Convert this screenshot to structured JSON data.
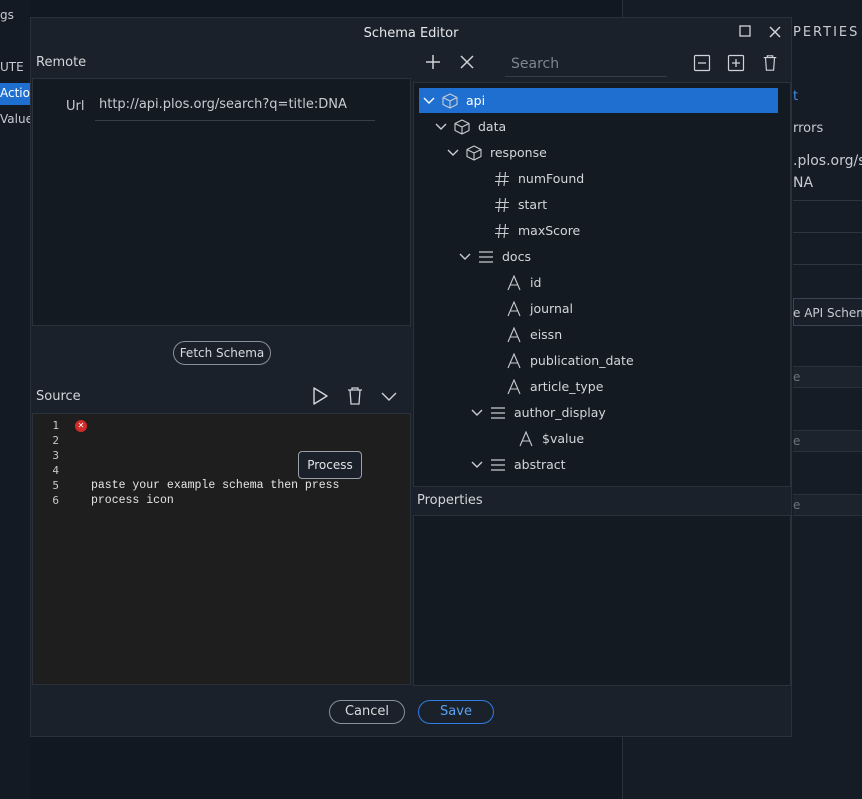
{
  "background_left": {
    "items": [
      "gs",
      "UTE",
      "Actio",
      "Value"
    ]
  },
  "background_right": {
    "header": "PERTIES",
    "items": [
      "t",
      "rrors",
      ".plos.org/s",
      "NA",
      "e API Schema",
      "e",
      "e",
      "e"
    ]
  },
  "dialog": {
    "title": "Schema Editor",
    "remote": {
      "section_label": "Remote",
      "url_label": "Url",
      "url_value": "http://api.plos.org/search?q=title:DNA",
      "fetch_button": "Fetch Schema"
    },
    "source": {
      "section_label": "Source",
      "line_numbers": [
        "1",
        "2",
        "3",
        "4",
        "5",
        "6"
      ],
      "lines": [
        "",
        "",
        "",
        "",
        "paste your example schema then press",
        "process icon"
      ],
      "tooltip": "Process"
    },
    "tree": {
      "search_placeholder": "Search",
      "nodes": [
        {
          "label": "api",
          "icon": "cube-icon",
          "expanded": true,
          "selected": true
        },
        {
          "label": "data",
          "icon": "cube-icon",
          "expanded": true
        },
        {
          "label": "response",
          "icon": "cube-icon",
          "expanded": true
        },
        {
          "label": "numFound",
          "icon": "hash-icon"
        },
        {
          "label": "start",
          "icon": "hash-icon"
        },
        {
          "label": "maxScore",
          "icon": "hash-icon"
        },
        {
          "label": "docs",
          "icon": "list-icon",
          "expanded": true
        },
        {
          "label": "id",
          "icon": "text-icon"
        },
        {
          "label": "journal",
          "icon": "text-icon"
        },
        {
          "label": "eissn",
          "icon": "text-icon"
        },
        {
          "label": "publication_date",
          "icon": "text-icon"
        },
        {
          "label": "article_type",
          "icon": "text-icon"
        },
        {
          "label": "author_display",
          "icon": "list-icon",
          "expanded": true
        },
        {
          "label": "$value",
          "icon": "text-icon"
        },
        {
          "label": "abstract",
          "icon": "list-icon",
          "expanded": true
        }
      ]
    },
    "properties": {
      "section_label": "Properties"
    },
    "footer": {
      "cancel": "Cancel",
      "save": "Save"
    }
  },
  "colors": {
    "accent": "#1f6fd0",
    "error": "#d02b2b"
  }
}
